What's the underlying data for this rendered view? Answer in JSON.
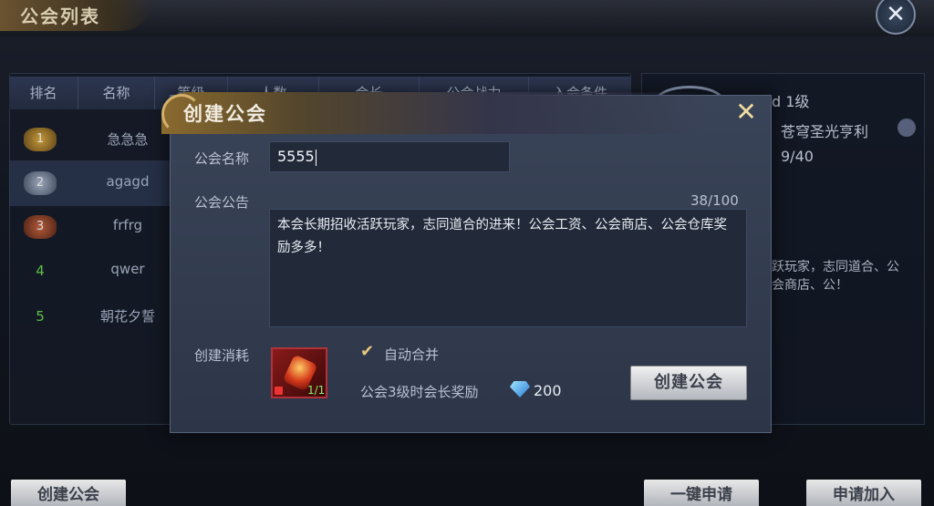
{
  "background": {
    "title": "公会列表",
    "close_icon": "close-icon",
    "table_headers": [
      "排名",
      "名称",
      "等级",
      "人数",
      "会长",
      "公会战力",
      "入会条件"
    ],
    "rows": [
      {
        "rank": "1",
        "name": "急急急"
      },
      {
        "rank": "2",
        "name": "agagd"
      },
      {
        "rank": "3",
        "name": "frfrg"
      },
      {
        "rank": "4",
        "name": "qwer"
      },
      {
        "rank": "5",
        "name": "朝花夕誓"
      }
    ],
    "info": {
      "name_level": "d  1级",
      "leader": "苍穹圣光亨利",
      "members": "9/40",
      "notice_partial": "跃玩家，志同道合、公会商店、公！"
    },
    "bottom_buttons": {
      "create": "创建公会",
      "one_click": "一键申请",
      "apply": "申请加入"
    }
  },
  "modal": {
    "title": "创建公会",
    "name_label": "公会名称",
    "name_value": "5555",
    "notice_label": "公会公告",
    "notice_counter": "38/100",
    "notice_text": "本会长期招收活跃玩家，志同道合的进来！公会工资、公会商店、公会仓库奖励多多！",
    "cost_label": "创建消耗",
    "item_count": "1/1",
    "auto_merge_label": "自动合并",
    "reward_label": "公会3级时会长奖励",
    "reward_amount": "200",
    "create_button": "创建公会"
  }
}
